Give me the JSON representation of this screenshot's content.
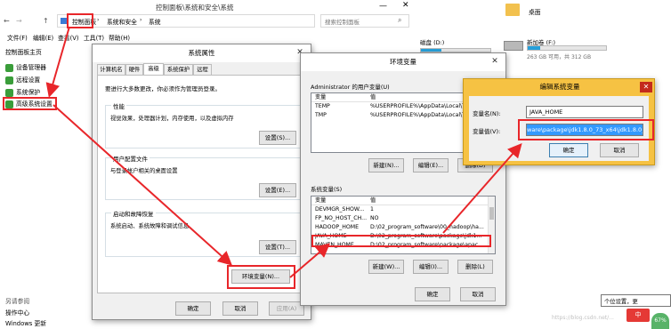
{
  "explorer": {
    "title": "控制面板\\系统和安全\\系统",
    "breadcrumb": [
      "控制面板",
      "系统和安全",
      "系统"
    ],
    "search_placeholder": "搜索控制面板",
    "nav_arrows": [
      "←",
      "→",
      "↑"
    ],
    "menu": [
      "文件(F)",
      "编辑(E)",
      "查看(V)",
      "工具(T)",
      "帮助(H)"
    ],
    "sidebar": {
      "home": "控制面板主页",
      "items": [
        "设备管理器",
        "远程设置",
        "系统保护",
        "高级系统设置"
      ],
      "see_also": "另请参阅",
      "bottom": [
        "操作中心",
        "Windows 更新"
      ]
    }
  },
  "right_panel": {
    "desktop": "桌面",
    "drive_d": "磁盘 (D:)",
    "new_volume": "新加卷 (F:)",
    "drive_f_size": "263 GB 可用，共 312 GB",
    "drive_f_fill": 0.16,
    "tooltip": "个位设置，更",
    "watermark": "https://blog.csdn.net/...",
    "badge_cn": "中",
    "badge_pct": "67%"
  },
  "sysprops": {
    "title": "系统属性",
    "tabs": [
      "计算机名",
      "硬件",
      "高级",
      "系统保护",
      "远程"
    ],
    "admin_note": "要进行大多数更改，你必须作为管理员登录。",
    "performance_title": "性能",
    "performance_desc": "视觉效果，处理器计划，内存使用，以及虚拟内存",
    "profile_title": "用户配置文件",
    "profile_desc": "与登录帐户相关的桌面设置",
    "startup_title": "启动和故障恢复",
    "startup_desc": "系统启动、系统故障和调试信息",
    "settings_btn": "设置(S)...",
    "settings_btn2": "设置(E)...",
    "settings_btn3": "设置(T)...",
    "env_btn": "环境变量(N)...",
    "ok": "确定",
    "cancel": "取消",
    "apply": "应用(A)"
  },
  "envvars": {
    "title": "环境变量",
    "user_title": "Administrator 的用户变量(U)",
    "col_var": "变量",
    "col_val": "值",
    "user_vars": [
      {
        "name": "TEMP",
        "value": "%USERPROFILE%\\AppData\\Local\\Te"
      },
      {
        "name": "TMP",
        "value": "%USERPROFILE%\\AppData\\Local\\Te"
      }
    ],
    "new_btn": "新建(N)...",
    "edit_btn": "编辑(E)...",
    "delete_btn": "删除(D)",
    "sys_title": "系统变量(S)",
    "sys_vars": [
      {
        "name": "DEVMGR_SHOW...",
        "value": "1"
      },
      {
        "name": "FP_NO_HOST_CH...",
        "value": "NO"
      },
      {
        "name": "HADOOP_HOME",
        "value": "D:\\02_program_software\\00_hadoop\\ha..."
      },
      {
        "name": "JAVA_HOME",
        "value": "D:\\02_program_software\\package\\jdk1..."
      },
      {
        "name": "MAVEN_HOME",
        "value": "D:\\02_program_software\\package\\apac..."
      }
    ],
    "new_btn2": "新建(W)...",
    "edit_btn2": "编辑(I)...",
    "delete_btn2": "删除(L)",
    "ok": "确定",
    "cancel": "取消"
  },
  "editvar": {
    "title": "编辑系统变量",
    "name_label": "变量名(N):",
    "name_value": "JAVA_HOME",
    "value_label": "变量值(V):",
    "value_value": "ware\\package\\jdk1.8.0_73_x64\\jdk1.8.0_73",
    "ok": "确定",
    "cancel": "取消"
  },
  "colors": {
    "accent_red": "#e8262a",
    "edit_title": "#f6c243",
    "selection": "#3399ff"
  }
}
